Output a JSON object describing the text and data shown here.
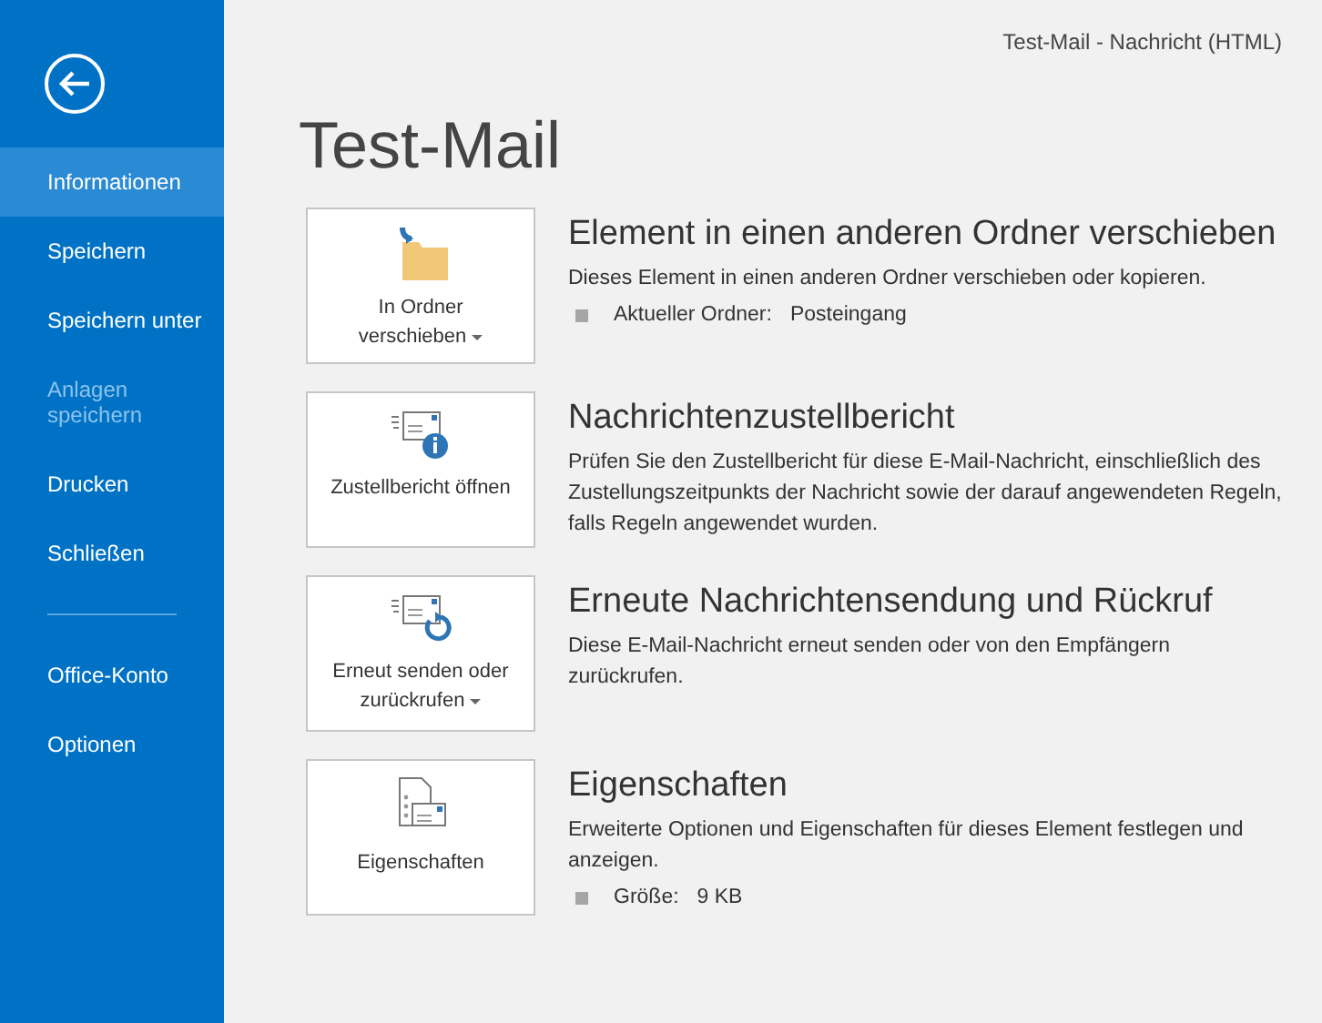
{
  "window": {
    "title": "Test-Mail - Nachricht (HTML)"
  },
  "sidebar": {
    "items": [
      {
        "label": "Informationen",
        "selected": true,
        "disabled": false
      },
      {
        "label": "Speichern",
        "selected": false,
        "disabled": false
      },
      {
        "label": "Speichern unter",
        "selected": false,
        "disabled": false
      },
      {
        "label": "Anlagen speichern",
        "selected": false,
        "disabled": true
      },
      {
        "label": "Drucken",
        "selected": false,
        "disabled": false
      },
      {
        "label": "Schließen",
        "selected": false,
        "disabled": false
      },
      {
        "kind": "divider"
      },
      {
        "label": "Office-Konto",
        "selected": false,
        "disabled": false
      },
      {
        "label": "Optionen",
        "selected": false,
        "disabled": false
      }
    ]
  },
  "heading": "Test-Mail",
  "sections": [
    {
      "kind": "move",
      "button": "In Ordner verschieben",
      "dropdown": true,
      "title": "Element in einen anderen Ordner verschieben",
      "description": "Dieses Element in einen anderen Ordner verschieben oder kopieren.",
      "details": [
        {
          "label": "Aktueller Ordner:",
          "value": "Posteingang"
        }
      ]
    },
    {
      "kind": "report",
      "button": "Zustellbericht öffnen",
      "dropdown": false,
      "title": "Nachrichtenzustellbericht",
      "description": "Prüfen Sie den Zustellbericht für diese E-Mail-Nachricht, einschließlich des Zustellungszeitpunkts der Nachricht sowie der darauf angewendeten Regeln, falls Regeln angewendet wurden."
    },
    {
      "kind": "resend",
      "button": "Erneut senden oder zurückrufen",
      "dropdown": true,
      "title": "Erneute Nachrichtensendung und Rückruf",
      "description": "Diese E-Mail-Nachricht erneut senden oder von den Empfängern zurückrufen."
    },
    {
      "kind": "properties",
      "button": "Eigenschaften",
      "dropdown": false,
      "title": "Eigenschaften",
      "description": "Erweiterte Optionen und Eigenschaften für dieses Element festlegen und anzeigen.",
      "details": [
        {
          "label": "Größe:",
          "value": "9 KB"
        }
      ]
    }
  ]
}
